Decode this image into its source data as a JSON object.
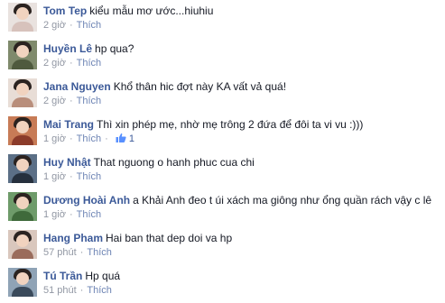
{
  "colors": {
    "author": "#3b5998",
    "meta": "#9197a3",
    "like_link": "#6d84b4",
    "text": "#141823"
  },
  "comments": [
    {
      "author": "Tom Tep",
      "text": "kiểu mẫu mơ ước...hiuhiu",
      "time": "2 giờ",
      "like_label": "Thích",
      "avatar_icon": "user-avatar-icon",
      "avatar_colors": {
        "bg": "#e9e2df",
        "body": "#d7c2bc"
      }
    },
    {
      "author": "Huyền Lê",
      "text": "hp qua?",
      "time": "2 giờ",
      "like_label": "Thích",
      "avatar_icon": "user-avatar-icon",
      "avatar_colors": {
        "bg": "#7f8a6c",
        "body": "#4f5a3e"
      }
    },
    {
      "author": "Jana Nguyen",
      "text": "Khổ thân hic đợt này KA vất vả quá!",
      "time": "2 giờ",
      "like_label": "Thích",
      "avatar_icon": "user-avatar-icon",
      "avatar_colors": {
        "bg": "#e8ddd6",
        "body": "#b98e7b"
      }
    },
    {
      "author": "Mai Trang",
      "text": "Thì xin phép mẹ, nhờ mẹ trông 2 đứa để đôi ta vi vu :)))",
      "time": "1 giờ",
      "like_label": "Thích",
      "like_count": "1",
      "avatar_icon": "user-avatar-icon",
      "avatar_colors": {
        "bg": "#c77b56",
        "body": "#8b3b2a"
      }
    },
    {
      "author": "Huy Nhật",
      "text": "That nguong o hanh phuc cua chi",
      "time": "1 giờ",
      "like_label": "Thích",
      "avatar_icon": "user-avatar-icon",
      "avatar_colors": {
        "bg": "#5b6f86",
        "body": "#26303d"
      }
    },
    {
      "author": "Dương Hoài Anh",
      "text": "a Khải Anh đeo t úi xách ma giông như ổng quần rách vậy c lê",
      "time": "1 giờ",
      "like_label": "Thích",
      "avatar_icon": "user-avatar-icon",
      "avatar_colors": {
        "bg": "#6e9b6a",
        "body": "#3f6a3b"
      }
    },
    {
      "author": "Hang Pham",
      "text": "Hai ban that dep doi va hp",
      "time": "57 phút",
      "like_label": "Thích",
      "avatar_icon": "user-avatar-icon",
      "avatar_colors": {
        "bg": "#d9c7bd",
        "body": "#9a6c5c"
      }
    },
    {
      "author": "Tú Trần",
      "text": "Hp quá",
      "time": "51 phút",
      "like_label": "Thích",
      "avatar_icon": "user-avatar-icon",
      "avatar_colors": {
        "bg": "#8fa3b6",
        "body": "#3a4a5b"
      }
    }
  ]
}
